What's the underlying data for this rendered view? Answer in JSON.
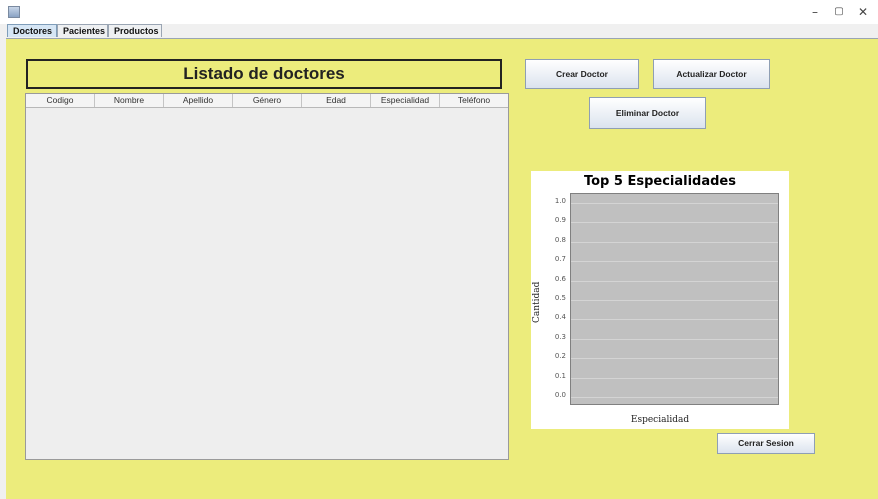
{
  "window": {
    "minimize": "–",
    "maximize": "▢",
    "close": "✕"
  },
  "tabs": [
    {
      "label": "Doctores",
      "active": true
    },
    {
      "label": "Pacientes",
      "active": false
    },
    {
      "label": "Productos",
      "active": false
    }
  ],
  "panel": {
    "background": "#ecec7c",
    "list_title": "Listado de doctores",
    "table": {
      "columns": [
        "Codigo",
        "Nombre",
        "Apellido",
        "Género",
        "Edad",
        "Especialidad",
        "Teléfono"
      ],
      "rows": []
    },
    "buttons": {
      "create": "Crear Doctor",
      "update": "Actualizar Doctor",
      "delete": "Eliminar Doctor",
      "logout": "Cerrar Sesion"
    }
  },
  "chart_data": {
    "type": "bar",
    "title": "Top 5 Especialidades",
    "xlabel": "Especialidad",
    "ylabel": "Cantidad",
    "categories": [],
    "values": [],
    "ylim": [
      0,
      1
    ],
    "yticks": [
      "0.0",
      "0.1",
      "0.2",
      "0.3",
      "0.4",
      "0.5",
      "0.6",
      "0.7",
      "0.8",
      "0.9",
      "1.0"
    ],
    "grid": true,
    "plot_background": "#c0c0c0"
  }
}
